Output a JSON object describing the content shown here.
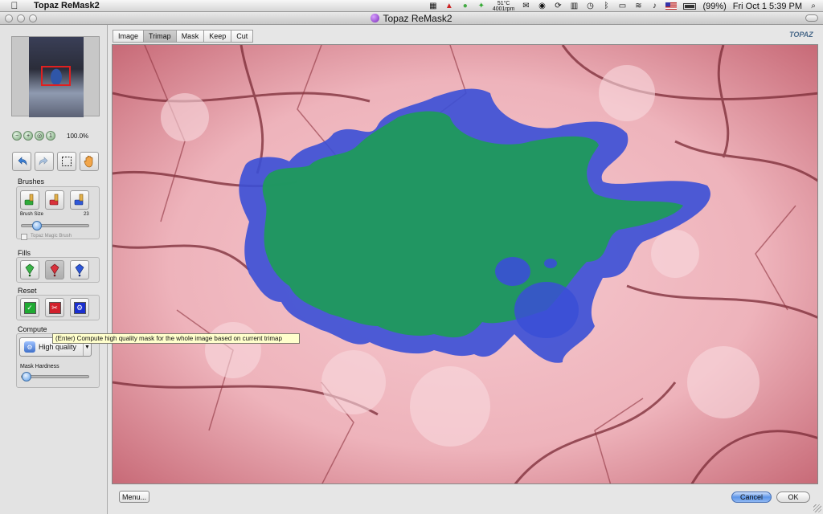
{
  "menubar": {
    "app_name": "Topaz ReMask2",
    "temperature": "51°C",
    "fan": "4001rpm",
    "battery": "(99%)",
    "clock": "Fri Oct 1  5:39 PM"
  },
  "window": {
    "title": "Topaz ReMask2"
  },
  "navigator": {
    "zoom": "100.0%"
  },
  "brushes": {
    "label": "Brushes",
    "size_label": "Brush Size",
    "size_value": "23",
    "size_fraction": 0.18,
    "magic_brush_label": "Topaz Magic Brush"
  },
  "fills": {
    "label": "Fills"
  },
  "reset": {
    "label": "Reset"
  },
  "compute": {
    "label": "Compute",
    "selected": "High quality",
    "hardness_label": "Mask Hardness",
    "hardness_fraction": 0.0
  },
  "tooltip": "(Enter) Compute high quality mask for the whole image based on current trimap",
  "tabs": [
    {
      "label": "Image"
    },
    {
      "label": "Trimap"
    },
    {
      "label": "Mask"
    },
    {
      "label": "Keep"
    },
    {
      "label": "Cut"
    }
  ],
  "logo_text": "TOPAZ",
  "footer": {
    "menu_label": "Menu...",
    "cancel_label": "Cancel",
    "ok_label": "OK"
  },
  "colors": {
    "keep_fill": "#1f9a5c",
    "cut_fill": "#c8505f",
    "unknown_fill": "#3a4fd6",
    "accent": "#5d96e8"
  }
}
